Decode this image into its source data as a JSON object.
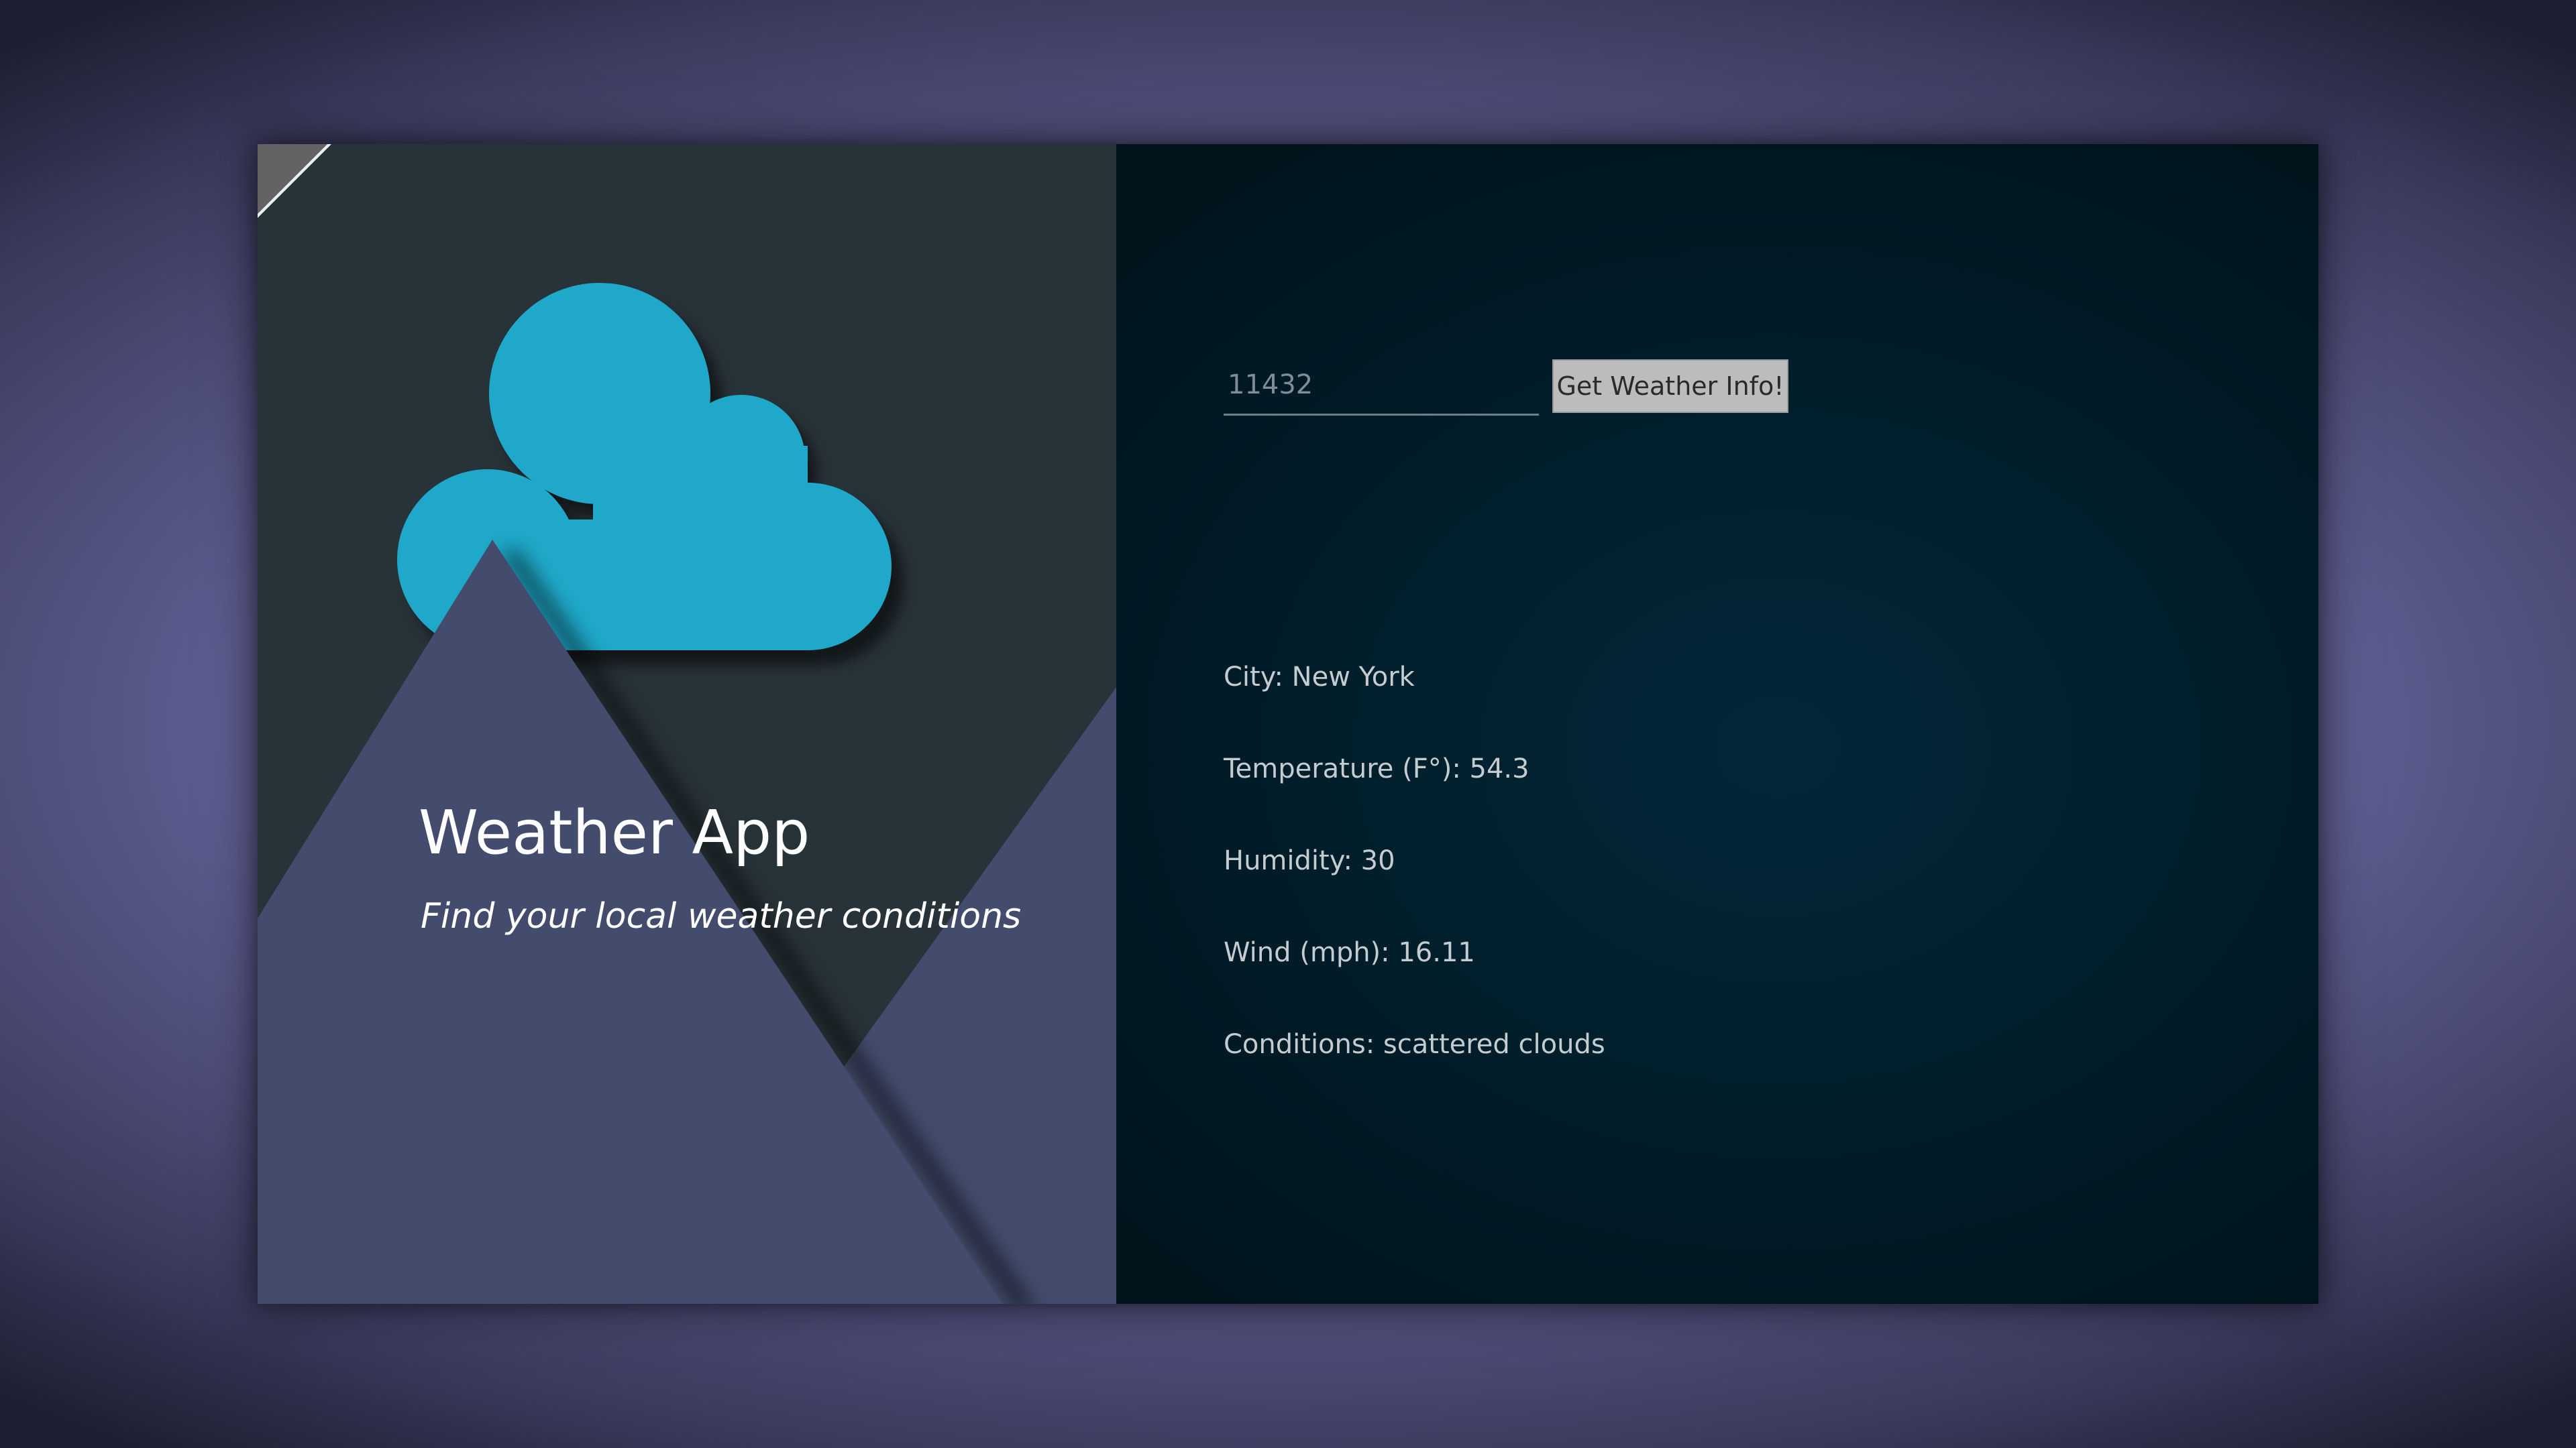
{
  "app": {
    "title": "Weather App",
    "subtitle": "Find your local weather conditions"
  },
  "search": {
    "zip_value": "",
    "placeholder": "11432",
    "button_label": "Get Weather Info!"
  },
  "weather": {
    "city": "City: New York",
    "temperature": "Temperature (F°): 54.3",
    "humidity": "Humidity: 30",
    "wind": "Wind (mph): 16.11",
    "conditions": "Conditions: scattered clouds"
  },
  "colors": {
    "cloud": "#1fa8c9",
    "mountain": "#434c6c",
    "left_panel": "#283339",
    "right_panel": "#011d29",
    "button": "#bcbcbc"
  },
  "icons": {
    "cloud": "cloud-icon",
    "mountains": "mountain-illustration"
  }
}
